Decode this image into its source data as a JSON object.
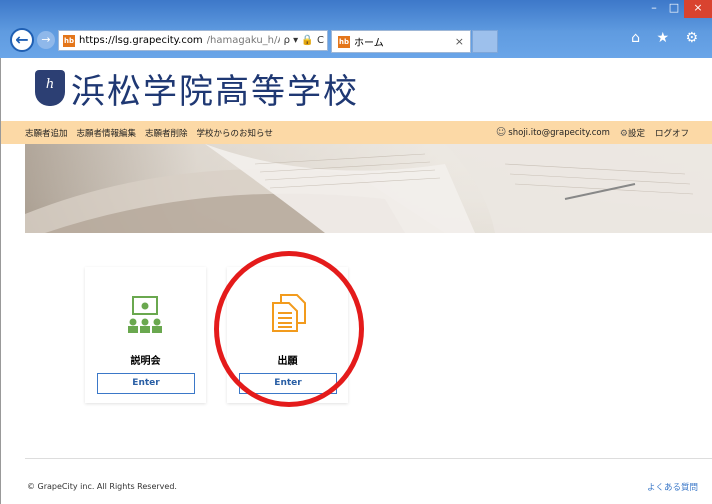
{
  "browser": {
    "url_host": "https://lsg.grapecity.com",
    "url_path": "/hamagaku_h/App?from=lc",
    "tab_title": "ホーム",
    "favicon_text": "hb",
    "window_buttons": [
      "–",
      "□",
      "×"
    ],
    "addr_icons": "ρ ▾ 🔒 C",
    "tool_icons": "⌂ ★ ⚙"
  },
  "header": {
    "school_name": "浜松学院高等学校",
    "crest_text": "h"
  },
  "nav": {
    "items": [
      "志願者追加",
      "志願者情報編集",
      "志願者削除",
      "学校からのお知らせ"
    ],
    "user_email": "shoji.ito@grapecity.com",
    "settings_label": "設定",
    "logout_label": "ログオフ"
  },
  "cards": [
    {
      "title": "説明会",
      "button": "Enter",
      "icon": "presentation-icon",
      "color": "#6aa84f"
    },
    {
      "title": "出願",
      "button": "Enter",
      "icon": "documents-icon",
      "color": "#f29b1d"
    }
  ],
  "footer": {
    "copyright": "© GrapeCity inc. All Rights Reserved.",
    "faq": "よくある質問"
  }
}
